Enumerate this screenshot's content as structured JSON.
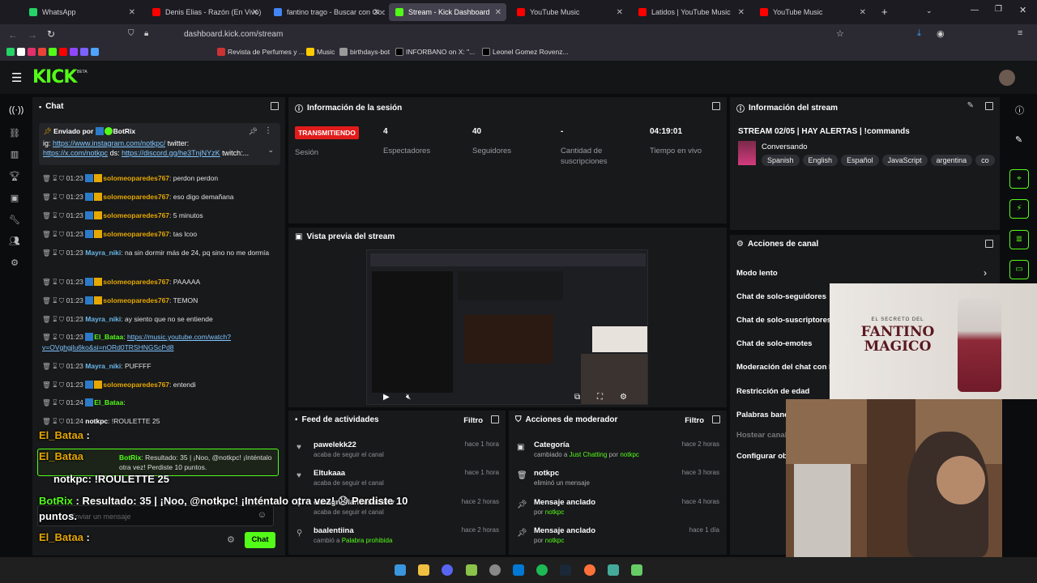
{
  "browser": {
    "tabs": [
      {
        "label": "WhatsApp",
        "color": "#25d366"
      },
      {
        "label": "Denis Elias - Razón (En Vivo) - Y",
        "color": "#ff0000"
      },
      {
        "label": "fantino trago - Buscar con Goo",
        "color": "#4285f4"
      },
      {
        "label": "Stream - Kick Dashboard",
        "color": "#53fc18",
        "active": true
      },
      {
        "label": "YouTube Music",
        "color": "#ff0000"
      },
      {
        "label": "Latidos | YouTube Music",
        "color": "#ff0000"
      },
      {
        "label": "YouTube Music",
        "color": "#ff0000"
      }
    ],
    "url": "dashboard.kick.com/stream",
    "bookmarks": [
      "Revista de Perfumes y ...",
      "Music",
      "birthdays-bot",
      "INFORBANO on X: \"...",
      "Leonel Gomez Rovenz..."
    ]
  },
  "app": {
    "logo": "KICK",
    "logo_sup": "BETA",
    "accent": "#53fc18"
  },
  "chat": {
    "title": "Chat",
    "pinned": {
      "header": "Enviado por",
      "user": "BotRix",
      "text_prefix": "ig:",
      "link1": "https://www.instagram.com/notkpc/",
      "mid1": "twitter:",
      "link2": "https://x.com/notkpc",
      "mid2": "ds:",
      "link3": "https://discord.gg/he3TnjNYzK",
      "suffix": "twitch:..."
    },
    "messages": [
      {
        "time": "01:23",
        "user": "solomeoparedes767",
        "text": "perdon perdon",
        "style": "u"
      },
      {
        "time": "01:23",
        "user": "solomeoparedes767",
        "text": "eso digo demañana",
        "style": "u"
      },
      {
        "time": "01:23",
        "user": "solomeoparedes767",
        "text": "5 minutos",
        "style": "u"
      },
      {
        "time": "01:23",
        "user": "solomeoparedes767",
        "text": "tas lcoo",
        "style": "u"
      },
      {
        "time": "01:23",
        "user": "Mayra_niki",
        "text": "na sin dormir más de 24, pq sino no me dormía",
        "style": "ub"
      },
      {
        "time": "01:23",
        "user": "solomeoparedes767",
        "text": "PAAAAA",
        "style": "u"
      },
      {
        "time": "01:23",
        "user": "solomeoparedes767",
        "text": "TEMON",
        "style": "u"
      },
      {
        "time": "01:23",
        "user": "Mayra_niki",
        "text": "ay siento que no se entiende",
        "style": "ub"
      },
      {
        "time": "01:23",
        "user": "El_Bataa",
        "text": "https://music.youtube.com/watch?v=OVghgjlu6ko&si=nORd0TRSHNGScPd8",
        "style": "ug"
      },
      {
        "time": "01:23",
        "user": "Mayra_niki",
        "text": "PUFFFF",
        "style": "ub"
      },
      {
        "time": "01:23",
        "user": "solomeoparedes767",
        "text": "entendi",
        "style": "u"
      },
      {
        "time": "01:24",
        "user": "El_Bataa",
        "text": "",
        "style": "ug"
      },
      {
        "time": "01:24",
        "user": "notkpc",
        "text": "!ROULETTE 25",
        "style": "w"
      }
    ],
    "bot_reply": "Resultado: 35 | ¡Noo, @notkpc! ¡Inténtalo otra vez! Perdiste 10 puntos.",
    "bot_name": "BotRix",
    "input_placeholder": "Enviar un mensaje",
    "send_label": "Chat"
  },
  "overlay": {
    "line1_user": "El_Bataa",
    "line1_text": ":",
    "line2_user": "El_Bataa",
    "line3_user": "notkpc",
    "line3_text": ": !ROULETTE 25",
    "line4_user": "BotRix",
    "line4_text": ": Resultado: 35 | ¡Noo, @notkpc! ¡Inténtalo otra vez! 😞 Perdiste 10",
    "line4b": "puntos.",
    "line5_user": "El_Bataa"
  },
  "session": {
    "title": "Información de la sesión",
    "status": "TRANSMITIENDO",
    "status_label": "Sesión",
    "stats": [
      {
        "value": "4",
        "label": "Espectadores"
      },
      {
        "value": "40",
        "label": "Seguidores"
      },
      {
        "value": "-",
        "label": "Cantidad de suscripciones"
      },
      {
        "value": "04:19:01",
        "label": "Tiempo en vivo"
      }
    ]
  },
  "stream_info": {
    "title": "Información del stream",
    "stream_title": "STREAM 02/05 | HAY ALERTAS | !commands",
    "category": "Conversando",
    "tags": [
      "Spanish",
      "English",
      "Español",
      "JavaScript",
      "argentina",
      "co"
    ]
  },
  "preview": {
    "title": "Vista previa del stream"
  },
  "channel_actions": {
    "title": "Acciones de canal",
    "items": [
      "Modo lento",
      "Chat de solo-seguidores",
      "Chat de solo-suscriptores",
      "Chat de solo-emotes",
      "Moderación del chat con l",
      "Restricción de edad",
      "Palabras bane",
      "Hostear canal",
      "Configurar obj"
    ]
  },
  "activity_feed": {
    "title": "Feed de actividades",
    "filter": "Filtro",
    "items": [
      {
        "name": "pawelekk22",
        "sub": "acaba de seguir el canal",
        "time": "hace 1 hora"
      },
      {
        "name": "Eltukaaa",
        "sub": "acaba de seguir el canal",
        "time": "hace 1 hora"
      },
      {
        "name": "elmagnoflaneesodeltv",
        "sub": "acaba de seguir el canal",
        "time": "hace 2 horas"
      },
      {
        "name": "baalentiina",
        "sub_prefix": "cambió a",
        "sub_highlight": "Palabra prohibida",
        "time": "hace 2 horas"
      }
    ]
  },
  "mod_actions": {
    "title": "Acciones de moderador",
    "filter": "Filtro",
    "items": [
      {
        "name": "Categoría",
        "sub_prefix": "cambiado a",
        "hl1": "Just Chatting",
        "mid": "por",
        "hl2": "notkpc",
        "time": "hace 2 horas"
      },
      {
        "name": "notkpc",
        "sub": "eliminó un mensaje",
        "time": "hace 3 horas"
      },
      {
        "name": "Mensaje anclado",
        "sub_prefix": "por",
        "hl2": "notkpc",
        "time": "hace 4 horas"
      },
      {
        "name": "Mensaje anclado",
        "sub_prefix": "por",
        "hl2": "notkpc",
        "time": "hace 1 día"
      }
    ]
  },
  "poster": {
    "line1": "EL SECRETO DEL",
    "line2": "FANTINO",
    "line3": "MAGICO"
  }
}
